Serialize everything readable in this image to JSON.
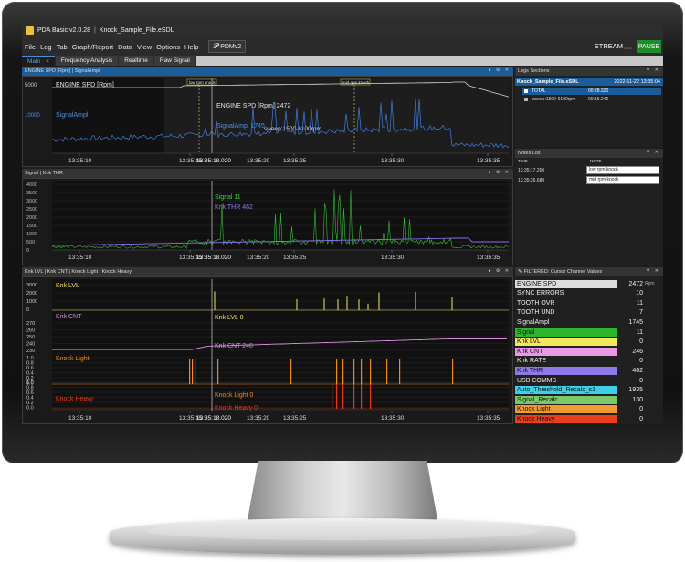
{
  "app": {
    "title": "PDA Basic v2.0.28",
    "separator": "|",
    "file": "Knock_Sample_File.eSDL"
  },
  "menu": [
    "File",
    "Log",
    "Tab",
    "Graph/Report",
    "Data",
    "View",
    "Options",
    "Help"
  ],
  "pdm_label": "PDMv2",
  "stream": {
    "label": "STREAM",
    "sub": "USB",
    "pause": "PAUSE"
  },
  "tabs": [
    {
      "label": "Main",
      "close": "×"
    },
    {
      "label": "Frequency Analysis"
    },
    {
      "label": "Realtime"
    },
    {
      "label": "Raw Signal"
    }
  ],
  "panel1": {
    "header": "ENGINE SPD [Rpm]  |  SignalAmpl",
    "yticks_top": [
      "5000"
    ],
    "yticks_bottom": [
      "10000"
    ],
    "label_spd": "ENGINE SPD [Rpm]",
    "label_sig": "SignalAmpl",
    "cursor_spd": "ENGINE SPD [Rpm] 2472",
    "cursor_sig": "SignalAmpl 1745",
    "marker_low": "low rpm knock",
    "marker_mid": "mid rpm knock",
    "sweep": "sweep:1500-6100rpm",
    "xticks": [
      "13:35:10",
      "13:35:15",
      "13:35:20",
      "13:35:25",
      "13:35:30",
      "13:35:35"
    ],
    "cursor_time": "13:35:18.020",
    "colors": {
      "spd": "#d8d8d8",
      "sig": "#3f7fe0"
    }
  },
  "panel2": {
    "header": "Signal  |  Knk THR",
    "yticks": [
      "4000",
      "3500",
      "3000",
      "2500",
      "2000",
      "1500",
      "1000",
      "500",
      "0"
    ],
    "cursor_signal": "Signal 11",
    "cursor_thr": "Knk THR 462",
    "xticks": [
      "13:35:10",
      "13:35:15",
      "13:35:20",
      "13:35:25",
      "13:35:30",
      "13:35:35"
    ],
    "cursor_time": "13:35:18.020",
    "colors": {
      "signal": "#2fc22f",
      "thr": "#8a6ee8"
    }
  },
  "panel3": {
    "header": "Knk LVL  |  Knk CNT  |  Knock Light  |  Knock Heavy",
    "lvl": {
      "label": "Knk LVL",
      "cursor": "Knk LVL 0",
      "yticks": [
        "3000",
        "2000",
        "1000",
        "0"
      ],
      "color": "#f2e65a"
    },
    "cnt": {
      "label": "Knk CNT",
      "cursor": "Knk CNT 246",
      "yticks": [
        "270",
        "260",
        "250",
        "240",
        "230"
      ],
      "color": "#d88ee0"
    },
    "light": {
      "label": "Knock Light",
      "cursor": "Knock Light 0",
      "yticks": [
        "1.0",
        "0.8",
        "0.6",
        "0.4",
        "0.2",
        "0.0"
      ],
      "color": "#f08a25"
    },
    "heavy": {
      "label": "Knock Heavy",
      "cursor": "Knock Heavy 0",
      "yticks": [
        "1.0",
        "0.8",
        "0.6",
        "0.4",
        "0.2",
        "0.0"
      ],
      "color": "#e83a1a"
    },
    "xticks": [
      "13:35:10",
      "13:35:15",
      "13:35:20",
      "13:35:25",
      "13:35:30",
      "13:35:35"
    ],
    "cursor_time": "13:35:18.020"
  },
  "log_sections": {
    "header": "Logs Sections",
    "file": "Knock_Sample_File.eSDL",
    "date": "2022-11-22 13:35:04",
    "rows": [
      {
        "name": "TOTAL",
        "time": "00:28.320"
      },
      {
        "name": "sweep:1500-6100rpm",
        "time": "00:15.240"
      }
    ]
  },
  "notes": {
    "header": "Notes List",
    "col_time": "TIME",
    "col_note": "NOTE",
    "rows": [
      {
        "time": "13:35:17.260",
        "note": "low rpm knock"
      },
      {
        "time": "13:35:26.680",
        "note": "mid rpm knock"
      }
    ]
  },
  "channels": {
    "header": "FILTERED: Cursor Channel Values",
    "rows": [
      {
        "name": "ENGINE SPD",
        "value": "2472",
        "unit": "Rpm",
        "bg": "#dcdcdc",
        "fg": "#111"
      },
      {
        "name": "SYNC ERRORS",
        "value": "10",
        "unit": "",
        "bg": "",
        "fg": "#eee"
      },
      {
        "name": "TOOTH OVR",
        "value": "11",
        "unit": "",
        "bg": "",
        "fg": "#eee"
      },
      {
        "name": "TOOTH UND",
        "value": "7",
        "unit": "",
        "bg": "",
        "fg": "#eee"
      },
      {
        "name": "SignalAmpl",
        "value": "1745",
        "unit": "",
        "bg": "",
        "fg": "#eee"
      },
      {
        "name": "Signal",
        "value": "11",
        "unit": "",
        "bg": "#2db52d",
        "fg": "#111"
      },
      {
        "name": "Knk LVL",
        "value": "0",
        "unit": "",
        "bg": "#f2ea5c",
        "fg": "#111"
      },
      {
        "name": "Knk CNT",
        "value": "246",
        "unit": "",
        "bg": "#e89ae8",
        "fg": "#111"
      },
      {
        "name": "Knk RATE",
        "value": "0",
        "unit": "",
        "bg": "",
        "fg": "#eee"
      },
      {
        "name": "Knk THR",
        "value": "462",
        "unit": "",
        "bg": "#8f78e8",
        "fg": "#111"
      },
      {
        "name": "USB COMMS",
        "value": "0",
        "unit": "",
        "bg": "",
        "fg": "#eee"
      },
      {
        "name": "Auto_Threshold_Recalc_s1",
        "value": "1935",
        "unit": "",
        "bg": "#3ccfe6",
        "fg": "#111"
      },
      {
        "name": "Signal_Recalc",
        "value": "130",
        "unit": "",
        "bg": "#7ac86a",
        "fg": "#111"
      },
      {
        "name": "Knock Light",
        "value": "0",
        "unit": "",
        "bg": "#f09a30",
        "fg": "#111"
      },
      {
        "name": "Knock Heavy",
        "value": "0",
        "unit": "",
        "bg": "#e8401e",
        "fg": "#111"
      }
    ]
  }
}
